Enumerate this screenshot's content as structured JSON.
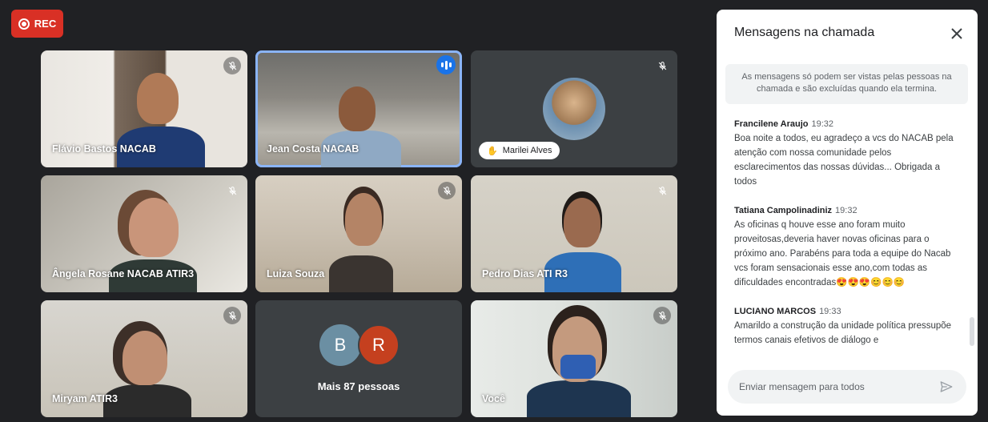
{
  "recording": {
    "label": "REC"
  },
  "tiles": [
    {
      "name": "Flávio Bastos NACAB"
    },
    {
      "name": "Jean Costa NACAB"
    },
    {
      "name": "Marilei Alves"
    },
    {
      "name": "Ângela Rosane NACAB ATIR3"
    },
    {
      "name": "Luiza Souza"
    },
    {
      "name": "Pedro Dias ATI R3"
    },
    {
      "name": "Miryam ATIR3"
    },
    {
      "name": "Mais 87 pessoas",
      "avatars": [
        "B",
        "R"
      ]
    },
    {
      "name": "Você"
    }
  ],
  "chat": {
    "title": "Mensagens na chamada",
    "notice": "As mensagens só podem ser vistas pelas pessoas na chamada e são excluídas quando ela termina.",
    "messages": [
      {
        "author": "Francilene Araujo",
        "time": "19:32",
        "text": "Boa noite a todos, eu agradeço a vcs do NACAB pela atenção com nossa comunidade pelos esclarecimentos das nossas dúvidas... Obrigada a todos"
      },
      {
        "author": "Tatiana Campolinadiniz",
        "time": "19:32",
        "text": "As oficinas q houve esse ano foram muito proveitosas,deveria haver novas oficinas para o próximo ano. Parabéns para toda a equipe do Nacab vcs foram sensacionais esse ano,com todas as dificuldades encontradas😍😍😍😊😊😊"
      },
      {
        "author": "LUCIANO MARCOS",
        "time": "19:33",
        "text": "Amarildo a construção da unidade política pressupõe termos canais efetivos de diálogo e"
      }
    ],
    "composer_placeholder": "Enviar mensagem para todos"
  },
  "colors": {
    "rec": "#d93025",
    "active_outline": "#8ab4f8",
    "speaking": "#1a73e8",
    "avatar_b": "#6b8fa3",
    "avatar_r": "#c5401f"
  }
}
